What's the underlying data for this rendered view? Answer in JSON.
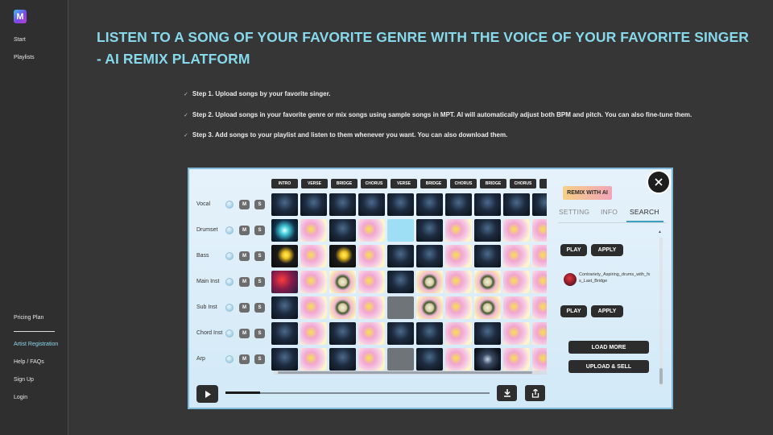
{
  "sidebar": {
    "logo_letter": "M",
    "top_links": [
      "Start",
      "Playlists"
    ],
    "bottom_links": [
      {
        "label": "Pricing Plan",
        "accent": false
      },
      {
        "label": "Artist Registration",
        "accent": true
      },
      {
        "label": "Help / FAQs",
        "accent": false
      },
      {
        "label": "Sign Up",
        "accent": false
      },
      {
        "label": "Login",
        "accent": false
      }
    ]
  },
  "main": {
    "headline": "LISTEN TO A SONG OF YOUR FAVORITE GENRE WITH THE VOICE OF YOUR FAVORITE SINGER - AI REMIX PLATFORM",
    "steps": [
      "Step 1. Upload songs by your favorite singer.",
      "Step 2. Upload songs in your favorite genre or mix songs using sample songs in MPT. AI will automatically adjust both BPM and pitch. You can also fine-tune them.",
      "Step 3. Add songs to your playlist and listen to them whenever you want. You can also download them."
    ]
  },
  "editor": {
    "sections": [
      "INTRO",
      "VERSE",
      "BRIDGE",
      "CHORUS",
      "VERSE",
      "BRIDGE",
      "CHORUS",
      "BRIDGE",
      "CHORUS",
      "OU"
    ],
    "mute_label": "M",
    "solo_label": "S",
    "tracks": [
      {
        "name": "Vocal",
        "clips": [
          "dark",
          "dark",
          "dark",
          "dark",
          "dark",
          "dark",
          "dark",
          "dark",
          "dark",
          "dark"
        ]
      },
      {
        "name": "Drumset",
        "clips": [
          "burst",
          "flower",
          "dark",
          "flower",
          "light",
          "dark",
          "flower",
          "dark",
          "flower",
          "flower"
        ]
      },
      {
        "name": "Bass",
        "clips": [
          "spark",
          "flower",
          "spark",
          "flower",
          "dark",
          "dark",
          "flower",
          "dark",
          "flower",
          "flower"
        ]
      },
      {
        "name": "Main Inst",
        "clips": [
          "red",
          "flower",
          "ring",
          "flower",
          "dark",
          "ring",
          "flower",
          "ring",
          "flower",
          "flower"
        ]
      },
      {
        "name": "Sub Inst",
        "clips": [
          "dark",
          "flower",
          "ring",
          "flower",
          "grey",
          "ring",
          "flower",
          "ring",
          "flower",
          "flower"
        ]
      },
      {
        "name": "Chord Inst",
        "clips": [
          "dark",
          "flower",
          "dark",
          "flower",
          "dark",
          "dark",
          "flower",
          "dark",
          "flower",
          "flower"
        ]
      },
      {
        "name": "Arp",
        "clips": [
          "dark",
          "flower",
          "dark",
          "flower",
          "grey",
          "dark",
          "flower",
          "darkwing",
          "flower",
          "flower"
        ]
      }
    ],
    "playback_progress": 0.13
  },
  "side_panel": {
    "badge": "REMIX WITH AI",
    "tabs": [
      "SETTING",
      "INFO",
      "SEARCH"
    ],
    "active_tab": "SEARCH",
    "play_label": "PLAY",
    "apply_label": "APPLY",
    "song_name": "Contrariety_Aspiring_drums_with_fxs_Last_Bridge",
    "load_more_label": "LOAD MORE",
    "upload_label": "UPLOAD & SELL"
  }
}
